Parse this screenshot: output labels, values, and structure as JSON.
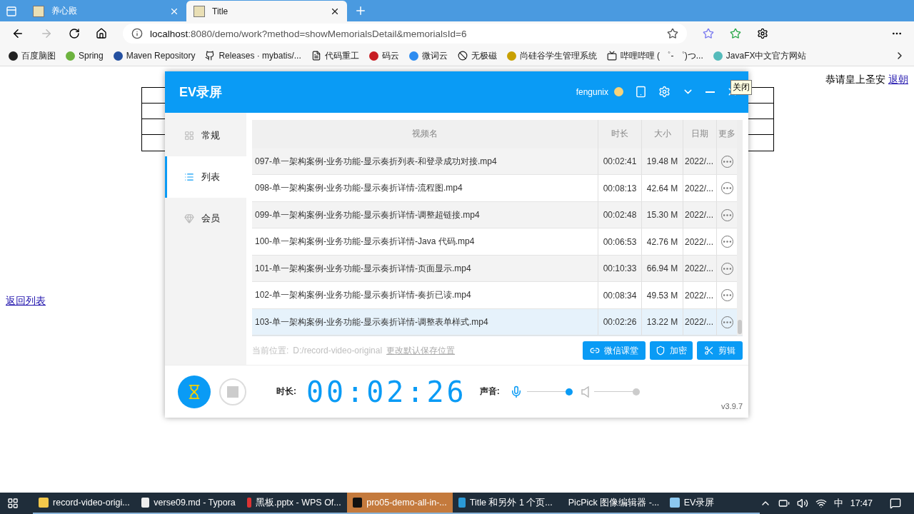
{
  "browser": {
    "tabs": [
      {
        "title": "养心殿",
        "selected": false
      },
      {
        "title": "Title",
        "selected": true
      }
    ],
    "url_host": "localhost",
    "url_rest": ":8080/demo/work?method=showMemorialsDetail&memorialsId=6",
    "bookmarks": [
      {
        "label": "百度脑图",
        "kind": "bd"
      },
      {
        "label": "Spring",
        "kind": "spring"
      },
      {
        "label": "Maven Repository",
        "kind": "mvn"
      },
      {
        "label": "Releases · mybatis/...",
        "kind": "github"
      },
      {
        "label": "代码重工",
        "kind": "doc"
      },
      {
        "label": "码云",
        "kind": "gitee"
      },
      {
        "label": "微词云",
        "kind": "w"
      },
      {
        "label": "无极磁",
        "kind": "circle"
      },
      {
        "label": "尚硅谷学生管理系统",
        "kind": "u"
      },
      {
        "label": "哔哩哔哩 ( ゜- ゜)つ...",
        "kind": "tv"
      },
      {
        "label": "JavaFX中文官方网站",
        "kind": "jfx"
      }
    ]
  },
  "page": {
    "greeting": "恭请皇上圣安",
    "logout_link": "退朝",
    "back_link": "返回列表"
  },
  "recorder": {
    "title": "EV录屏",
    "user": "fengunix",
    "tooltip": "关闭",
    "nav": [
      {
        "label": "常规",
        "selected": false,
        "kind": "grid"
      },
      {
        "label": "列表",
        "selected": true,
        "kind": "list"
      },
      {
        "label": "会员",
        "selected": false,
        "kind": "gem"
      }
    ],
    "columns": [
      "视频名",
      "时长",
      "大小",
      "日期",
      "更多"
    ],
    "rows": [
      {
        "name": "097-单一架构案例-业务功能-显示奏折列表-和登录成功对接.mp4",
        "duration": "00:02:41",
        "size": "19.48 M",
        "date": "2022/...",
        "selected": false
      },
      {
        "name": "098-单一架构案例-业务功能-显示奏折详情-流程图.mp4",
        "duration": "00:08:13",
        "size": "42.64 M",
        "date": "2022/...",
        "selected": false
      },
      {
        "name": "099-单一架构案例-业务功能-显示奏折详情-调整超链接.mp4",
        "duration": "00:02:48",
        "size": "15.30 M",
        "date": "2022/...",
        "selected": false
      },
      {
        "name": "100-单一架构案例-业务功能-显示奏折详情-Java 代码.mp4",
        "duration": "00:06:53",
        "size": "42.76 M",
        "date": "2022/...",
        "selected": false
      },
      {
        "name": "101-单一架构案例-业务功能-显示奏折详情-页面显示.mp4",
        "duration": "00:10:33",
        "size": "66.94 M",
        "date": "2022/...",
        "selected": false
      },
      {
        "name": "102-单一架构案例-业务功能-显示奏折详情-奏折已读.mp4",
        "duration": "00:08:34",
        "size": "49.53 M",
        "date": "2022/...",
        "selected": false
      },
      {
        "name": "103-单一架构案例-业务功能-显示奏折详情-调整表单样式.mp4",
        "duration": "00:02:26",
        "size": "13.22 M",
        "date": "2022/...",
        "selected": true
      }
    ],
    "location_label": "当前位置:",
    "location_path": "D:/record-video-original",
    "change_location": "更改默认保存位置",
    "actions": [
      {
        "label": "微信课堂",
        "kind": "link"
      },
      {
        "label": "加密",
        "kind": "shield"
      },
      {
        "label": "剪辑",
        "kind": "scissors"
      }
    ],
    "duration_label": "时长:",
    "timer": "00:02:26",
    "sound_label": "声音:",
    "mic": {
      "level": 1.0
    },
    "speaker": {
      "level": 1.0
    },
    "version": "v3.9.7"
  },
  "taskbar": {
    "items": [
      {
        "label": "record-video-origi...",
        "selected": false,
        "kind": "folder"
      },
      {
        "label": "verse09.md - Typora",
        "selected": false,
        "kind": "typora"
      },
      {
        "label": "黑板.pptx - WPS Of...",
        "selected": false,
        "kind": "wps"
      },
      {
        "label": "pro05-demo-all-in-...",
        "selected": true,
        "kind": "idea"
      },
      {
        "label": "Title 和另外 1 个页...",
        "selected": false,
        "kind": "edge"
      },
      {
        "label": "PicPick 图像编辑器 -...",
        "selected": false,
        "kind": "picpick"
      },
      {
        "label": "EV录屏",
        "selected": false,
        "kind": "ev"
      }
    ],
    "ime": "中",
    "time": "17:47"
  }
}
